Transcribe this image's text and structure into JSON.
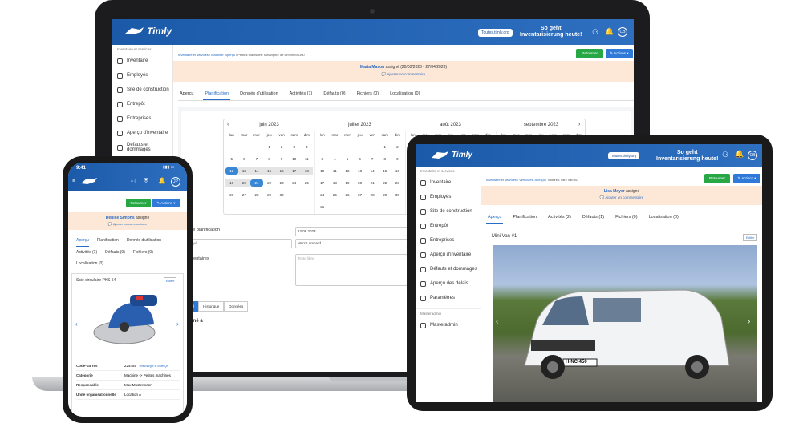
{
  "laptop": {
    "brand": "Timly",
    "tools_btn": "Toutes.timly.org",
    "slogan": "So geht\nInventarisierung heute!",
    "avatar": "CB",
    "sidebar_head": "Inventaire et services",
    "sidebar": [
      "Inventaire",
      "Employés",
      "Site de construction",
      "Entrepôt",
      "Entreprises",
      "Aperçu d'inventaire",
      "Défauts et dommages"
    ],
    "breadcrumb": [
      "Inventaire et services",
      "Machine: Aperçu",
      "Petites machines: Mélangeur de ciment M8100"
    ],
    "return_btn": "Retourner",
    "actions_btn": "Actions",
    "assign_name": "Maria Mason",
    "assign_rest": "assigné (20/03/2023 - 27/04/2023)",
    "assign_comment": "Ajouter un commentaire",
    "tabs": [
      "Aperçu",
      "Planification",
      "Donnés d'utilisation",
      "Activités (1)",
      "Défauts (0)",
      "Fichiers (0)",
      "Localisation (0)"
    ],
    "months": [
      "juin 2023",
      "juillet 2023",
      "août 2023",
      "septembre 2023"
    ],
    "weekdays": [
      "lun",
      "mar",
      "mer",
      "jeu",
      "ven",
      "sam",
      "dim"
    ],
    "june": [
      "",
      "",
      "",
      "1",
      "2",
      "3",
      "4",
      "5",
      "6",
      "7",
      "8",
      "9",
      "10",
      "11",
      "12",
      "13",
      "14",
      "15",
      "16",
      "17",
      "18",
      "19",
      "20",
      "21",
      "22",
      "23",
      "24",
      "25",
      "26",
      "27",
      "28",
      "29",
      "30",
      "",
      ""
    ],
    "july": [
      "",
      "",
      "",
      "",
      "",
      "1",
      "2",
      "3",
      "4",
      "5",
      "6",
      "7",
      "8",
      "9",
      "10",
      "11",
      "12",
      "13",
      "14",
      "15",
      "16",
      "17",
      "18",
      "19",
      "20",
      "21",
      "22",
      "23",
      "24",
      "25",
      "26",
      "27",
      "28",
      "29",
      "30",
      "31"
    ],
    "form_label1": "velle planification",
    "form_date": "12.06.2023",
    "form_emp_placeholder": "mployé",
    "form_emp_value": "Marc Lampard",
    "form_label2": "mmentaires",
    "form_text_placeholder": "Texte libre",
    "subtabs": [
      "nning",
      "Historique",
      "Données"
    ],
    "assigned_to": "signé à"
  },
  "phone": {
    "time": "9:41",
    "avatar": "JP",
    "return_btn": "Retourner",
    "actions_btn": "Actions",
    "assign_name": "Denise Simons",
    "assign_rest": "assigné",
    "assign_comment": "Ajouter un commentaire",
    "tabs": [
      "Aperçu",
      "Planification",
      "Donnés d'utilisation",
      "Activités (1)",
      "Défauts (0)",
      "Fichiers (0)",
      "Localisation (0)"
    ],
    "item_title": "Scie circulaire PKS 54",
    "edit_btn": "Editer",
    "rows": [
      {
        "k": "Code-barres",
        "v": "224455",
        "extra": "Télécharger le code QR"
      },
      {
        "k": "Catégorie",
        "v": "Machine -> Petites machines"
      },
      {
        "k": "Responsable",
        "v": "Max Mustermann"
      },
      {
        "k": "Unité organisationnelle",
        "v": "Location A"
      }
    ]
  },
  "tablet": {
    "brand": "Timly",
    "tools_btn": "Toutes.timly.org",
    "slogan": "So geht\nInventarisierung heute!",
    "avatar": "CB",
    "sidebar_head": "Inventaire et services",
    "sidebar": [
      "Inventaire",
      "Employés",
      "Site de construction",
      "Entrepôt",
      "Entreprises",
      "Aperçu d'inventaire",
      "Défauts et dommages",
      "Aperçu des délais",
      "Paramètres"
    ],
    "sidebar_head2": "Masteradmin",
    "sidebar2": [
      "Masteradmin"
    ],
    "breadcrumb": [
      "Inventaire et services",
      "Véhicules: Aperçu",
      "Voitures: Mini Van #1"
    ],
    "return_btn": "Retourner",
    "actions_btn": "Actions",
    "assign_name": "Lisa Mayer",
    "assign_rest": "assigné",
    "assign_comment": "Ajouter un commentaire",
    "tabs": [
      "Aperçu",
      "Planification",
      "Activités (2)",
      "Défauts (1)",
      "Fichiers (0)",
      "Localisation (0)"
    ],
    "item_title": "Mini Van #1",
    "edit_btn": "Editer",
    "plate": "H-NC 450"
  }
}
